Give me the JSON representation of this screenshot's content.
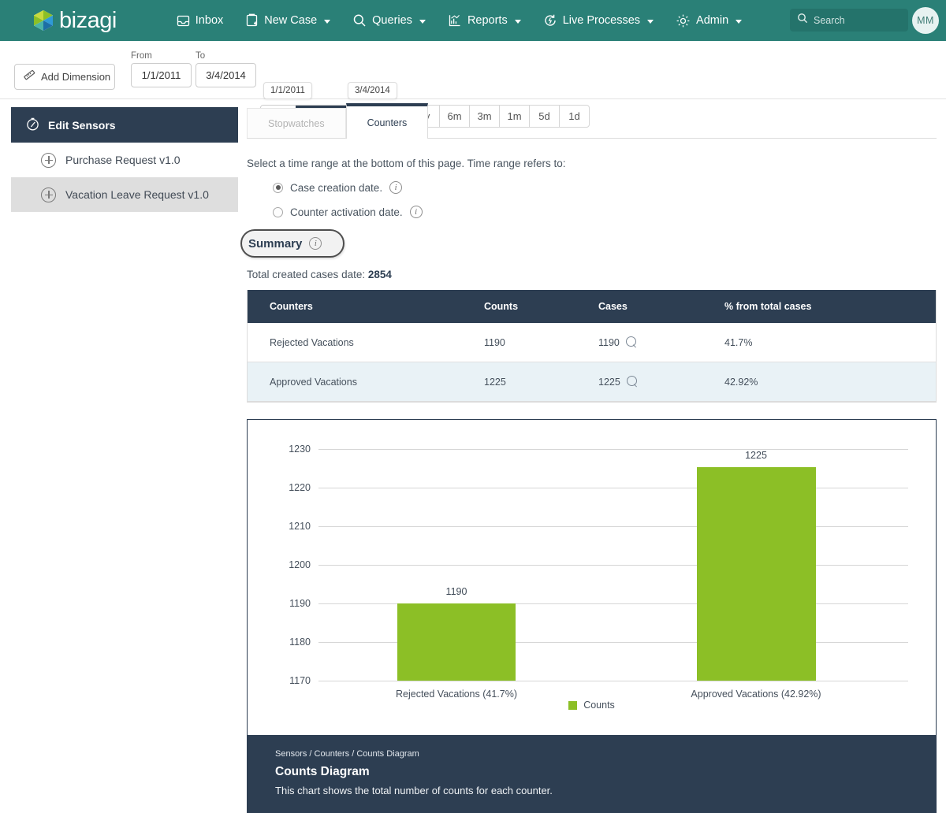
{
  "topnav": {
    "brand": "bizagi",
    "items": [
      {
        "label": "Inbox",
        "icon": "inbox-icon",
        "caret": false
      },
      {
        "label": "New Case",
        "icon": "new-case-icon",
        "caret": true
      },
      {
        "label": "Queries",
        "icon": "search-icon",
        "caret": true
      },
      {
        "label": "Reports",
        "icon": "reports-chart-icon",
        "caret": true
      },
      {
        "label": "Live Processes",
        "icon": "live-processes-icon",
        "caret": true
      },
      {
        "label": "Admin",
        "icon": "gear-icon",
        "caret": true
      }
    ],
    "search_placeholder": "Search",
    "avatar_initials": "MM"
  },
  "toolbar": {
    "add_dimension": "Add Dimension",
    "from_label": "From",
    "to_label": "To",
    "from_value": "1/1/2011",
    "to_value": "3/4/2014",
    "slider_left_tooltip": "1/1/2011",
    "slider_right_tooltip": "3/4/2014",
    "ranges": [
      "1y",
      "6m",
      "3m",
      "1m",
      "5d",
      "1d"
    ]
  },
  "sidebar": {
    "header": "Edit Sensors",
    "header_icon": "stopwatch-icon",
    "items": [
      {
        "label": "Purchase Request v1.0"
      },
      {
        "label": "Vacation Leave Request v1.0"
      }
    ]
  },
  "main": {
    "tabs": [
      {
        "label": "Stopwatches",
        "active": false
      },
      {
        "label": "Counters",
        "active": true
      }
    ],
    "hint": "Select a time range at the bottom of this page. Time range refers to:",
    "radios": [
      {
        "label": "Case creation date.",
        "selected": true
      },
      {
        "label": "Counter activation date.",
        "selected": false
      }
    ],
    "summary_title": "Summary",
    "total_prefix": "Total created cases date: ",
    "total_value": "2854"
  },
  "table": {
    "headers": [
      "Counters",
      "Counts",
      "Cases",
      "% from total cases"
    ],
    "rows": [
      {
        "counter": "Rejected Vacations",
        "counts": "1190",
        "cases": "1190",
        "percent": "41.7%"
      },
      {
        "counter": "Approved Vacations",
        "counts": "1225",
        "cases": "1225",
        "percent": "42.92%"
      }
    ]
  },
  "chart_footer": {
    "breadcrumb": "Sensors / Counters / Counts Diagram",
    "title": "Counts Diagram",
    "description": "This chart shows the total number of counts for each counter."
  },
  "colors": {
    "brand_teal": "#2a8077",
    "navy": "#2d3e52",
    "bar_green": "#8cbf26",
    "row_alt": "#e9f2f6"
  },
  "chart_data": {
    "type": "bar",
    "title": "Counts Diagram",
    "xlabel": "",
    "ylabel": "",
    "categories": [
      "Rejected Vacations (41.7%)",
      "Approved Vacations (42.92%)"
    ],
    "values": [
      1190,
      1225
    ],
    "data_labels": [
      "1190",
      "1225"
    ],
    "ylim": [
      1170,
      1230
    ],
    "yticks": [
      1230,
      1220,
      1210,
      1200,
      1190,
      1180,
      1170
    ],
    "grid": true,
    "legend": [
      {
        "name": "Counts",
        "color": "#8cbf26"
      }
    ],
    "legend_position": "bottom"
  }
}
